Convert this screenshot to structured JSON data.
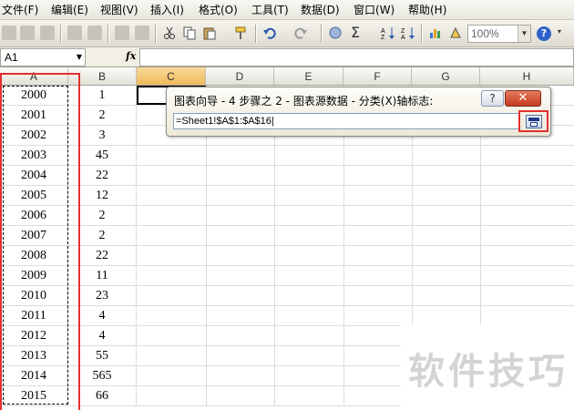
{
  "menu": [
    "文件(F)",
    "编辑(E)",
    "视图(V)",
    "插入(I)",
    "格式(O)",
    "工具(T)",
    "数据(D)",
    "窗口(W)",
    "帮助(H)"
  ],
  "toolbar": {
    "zoom": "100%",
    "sigma": "Σ",
    "help": "?",
    "colors": {
      "toolbar_bg": "#e9e7dd",
      "accent": "#2d63c8"
    }
  },
  "formula_bar": {
    "name_box": "A1",
    "fx_label": "fx",
    "value": ""
  },
  "columns": [
    "A",
    "B",
    "C",
    "D",
    "E",
    "F",
    "G",
    "H"
  ],
  "active_column": "C",
  "rows": [
    {
      "a": "2000",
      "b": "1"
    },
    {
      "a": "2001",
      "b": "2"
    },
    {
      "a": "2002",
      "b": "3"
    },
    {
      "a": "2003",
      "b": "45"
    },
    {
      "a": "2004",
      "b": "22"
    },
    {
      "a": "2005",
      "b": "12"
    },
    {
      "a": "2006",
      "b": "2"
    },
    {
      "a": "2007",
      "b": "2"
    },
    {
      "a": "2008",
      "b": "22"
    },
    {
      "a": "2009",
      "b": "11"
    },
    {
      "a": "2010",
      "b": "23"
    },
    {
      "a": "2011",
      "b": "4"
    },
    {
      "a": "2012",
      "b": "4"
    },
    {
      "a": "2013",
      "b": "55"
    },
    {
      "a": "2014",
      "b": "565"
    },
    {
      "a": "2015",
      "b": "66"
    }
  ],
  "dialog": {
    "title": "图表向导 - 4 步骤之 2 - 图表源数据 - 分类(X)轴标志:",
    "help_label": "?",
    "close_label": "✕",
    "input_value": "=Sheet1!$A$1:$A$16|",
    "highlight_color": "#e23030"
  },
  "watermark": "软件技巧"
}
